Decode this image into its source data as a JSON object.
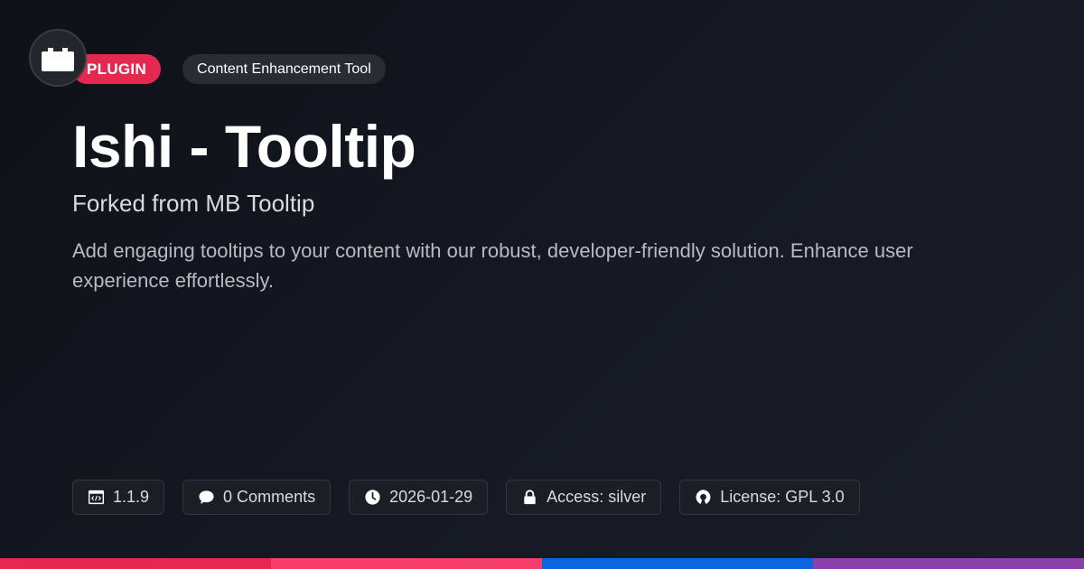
{
  "header": {
    "logo_icon": "plugin-icon",
    "type_badge": "PLUGIN",
    "category_badge": "Content Enhancement Tool"
  },
  "title": "Ishi - Tooltip",
  "subtitle": "Forked from MB Tooltip",
  "description": "Add engaging tooltips to your content with our robust, developer-friendly solution. Enhance user experience effortlessly.",
  "meta": {
    "version": {
      "icon": "code-window-icon",
      "label": "1.1.9"
    },
    "comments": {
      "icon": "comment-icon",
      "label": "0 Comments"
    },
    "date": {
      "icon": "clock-icon",
      "label": "2026-01-29"
    },
    "access": {
      "icon": "lock-icon",
      "label": "Access: silver"
    },
    "license": {
      "icon": "open-source-icon",
      "label": "License: GPL 3.0"
    }
  },
  "colors": {
    "accent": "#e5284f",
    "bar": [
      "#e5284f",
      "#f43f6b",
      "#0b64e0",
      "#8d3fad"
    ]
  }
}
